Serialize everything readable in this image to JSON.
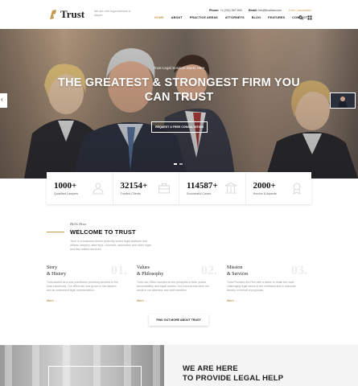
{
  "header": {
    "logo_text": "Trust",
    "tagline": "We are with legal advisors & lawyer",
    "phone_label": "Phone:",
    "phone_value": "+1 (234) 567-890",
    "email_label": "Email:",
    "email_value": "info@trustlaw.com",
    "cta": "Free Consultation",
    "nav": [
      "HOME",
      "ABOUT",
      "PRACTICE AREAS",
      "ATTORNEYS",
      "BLOG",
      "FEATURES",
      "CONTACT"
    ],
    "search_icon": "search-icon",
    "menu_icon": "grid-menu-icon",
    "accent": "#c39a4e"
  },
  "hero": {
    "subtitle": "Trust Legal Solution Starts Here",
    "title": "THE GREATEST & STRONGEST FIRM YOU CAN TRUST",
    "button": "REQUEST A FREE CONSULTATION"
  },
  "stats": [
    {
      "value": "1000+",
      "label": "Qualified Lawyers",
      "icon": "user-icon"
    },
    {
      "value": "32154+",
      "label": "Trusted Clients",
      "icon": "briefcase-icon"
    },
    {
      "value": "114587+",
      "label": "Successful Cases",
      "icon": "courthouse-icon"
    },
    {
      "value": "2000+",
      "label": "Honors & Awards",
      "icon": "award-icon"
    }
  ],
  "welcome": {
    "hello": "Hello Dear",
    "title": "WELCOME TO TRUST",
    "text": "Trust is a business theme perfectly suited legal advisors and offices, lawyers, attorneys, counsels, advocates and other legal and law related services."
  },
  "columns": [
    {
      "title1": "Story",
      "title2": "& History",
      "num": "01.",
      "text": "Trust started as a sole practitioner providing services to the local community. Our office has now grown to five lawyers and an undersized legal representation.",
      "more": "More →"
    },
    {
      "title1": "Values",
      "title2": "& Philosophy",
      "num": "02.",
      "text": "Trust Law Office founded on the principles of truth, justice, accountability, and equal access. Our success has been the result of our attorneys and staff members.",
      "more": "More →"
    },
    {
      "title1": "Mission",
      "title2": "& Services",
      "num": "03.",
      "text": "Trust Promises the Firm with a desire to retain the most challenging legal issues in the northwest and to advocate fiercely on behalf of proposals.",
      "more": "More →"
    }
  ],
  "about_button": "FIND OUT MORE ABOUT TRUST",
  "bottom": {
    "line1": "WE ARE HERE",
    "line2": "TO PROVIDE LEGAL HELP"
  }
}
